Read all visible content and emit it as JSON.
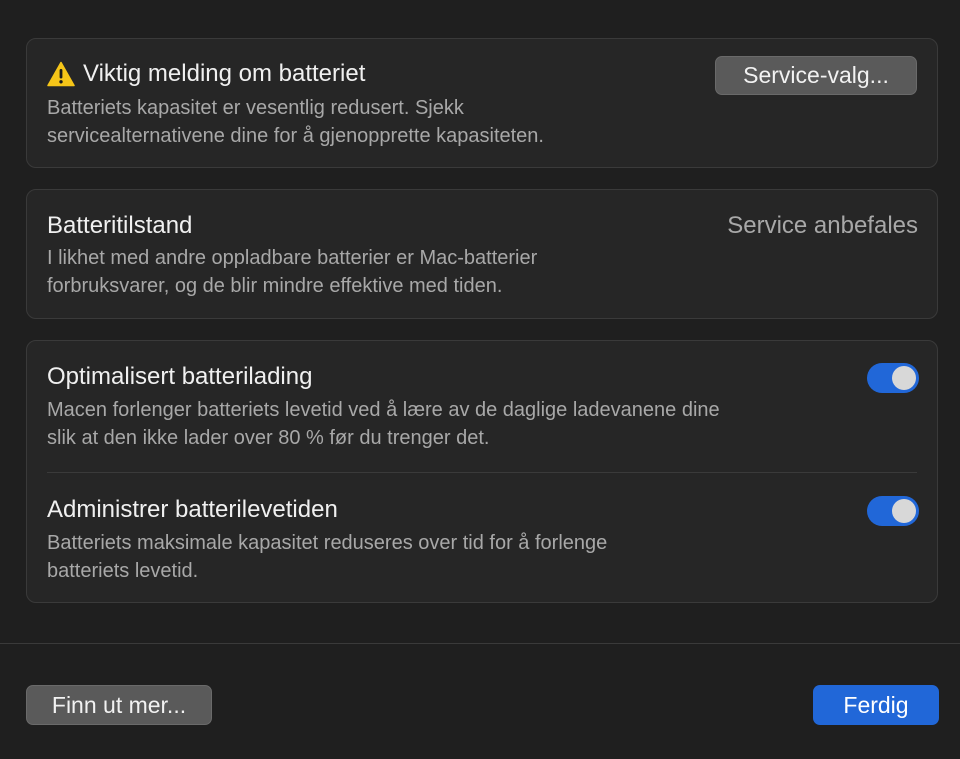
{
  "warning": {
    "title": "Viktig melding om batteriet",
    "description": "Batteriets kapasitet er vesentlig redusert. Sjekk\nservicealternativene dine for å gjenopprette kapasiteten.",
    "icon": "warning-triangle-icon",
    "service_button_label": "Service-valg..."
  },
  "health": {
    "title": "Batteritilstand",
    "status": "Service anbefales",
    "description": "I likhet med andre oppladbare batterier er Mac-batterier\nforbruksvarer, og de blir mindre effektive med tiden."
  },
  "optimized_charging": {
    "title": "Optimalisert batterilading",
    "description": "Macen forlenger batteriets levetid ved å lære av de daglige ladevanene dine\nslik at den ikke lader over 80 % før du trenger det.",
    "enabled": true
  },
  "battery_health_management": {
    "title": "Administrer batterilevetiden",
    "description": "Batteriets maksimale kapasitet reduseres over tid for å forlenge\nbatteriets levetid.",
    "enabled": true
  },
  "footer": {
    "learn_more_label": "Finn ut mer...",
    "done_label": "Ferdig"
  },
  "colors": {
    "accent": "#2167d8",
    "warning_icon": "#f5c518",
    "background": "#1f1f1f",
    "card": "#262626"
  }
}
